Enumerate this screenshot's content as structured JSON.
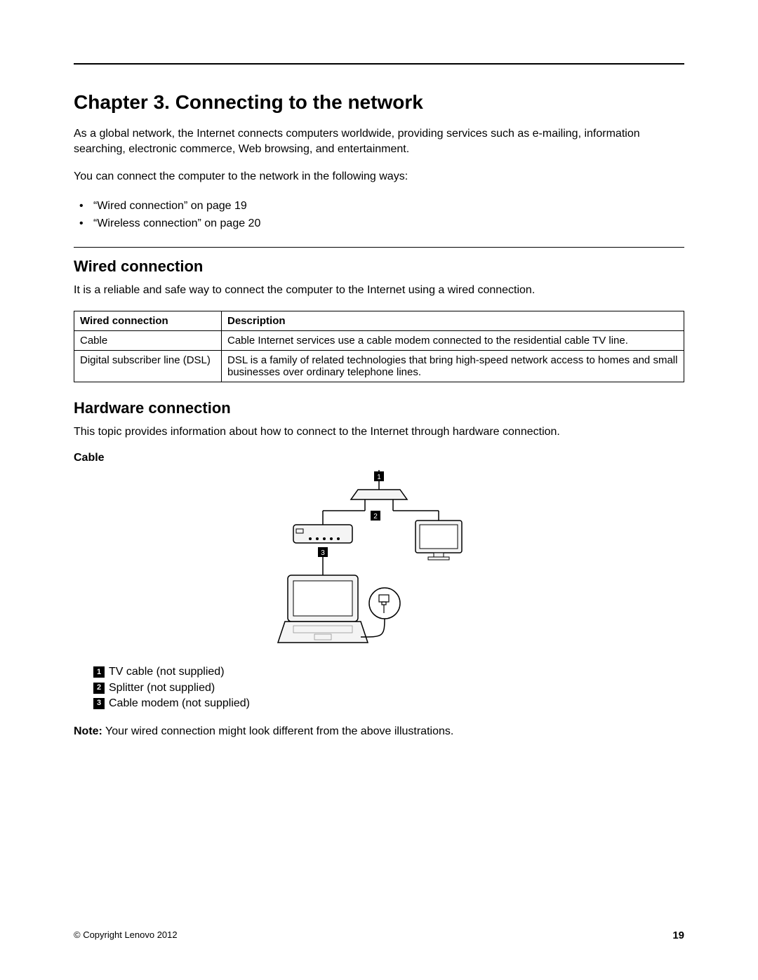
{
  "chapter_title": "Chapter 3.   Connecting to the network",
  "intro_p1": "As a global network, the Internet connects computers worldwide, providing services such as e-mailing, information searching, electronic commerce, Web browsing, and entertainment.",
  "intro_p2": "You can connect the computer to the network in the following ways:",
  "bullets": [
    "“Wired connection” on page 19",
    "“Wireless connection” on page 20"
  ],
  "wired": {
    "heading": "Wired connection",
    "intro": "It is a reliable and safe way to connect the computer to the Internet using a wired connection.",
    "table": {
      "headers": [
        "Wired connection",
        "Description"
      ],
      "rows": [
        [
          "Cable",
          "Cable Internet services use a cable modem connected to the residential cable TV line."
        ],
        [
          "Digital subscriber line (DSL)",
          "DSL is a family of related technologies that bring high-speed network access to homes and small businesses over ordinary telephone lines."
        ]
      ]
    }
  },
  "hardware": {
    "heading": "Hardware connection",
    "intro": "This topic provides information about how to connect to the Internet through hardware connection.",
    "sub_heading": "Cable",
    "legend": [
      {
        "num": "1",
        "text": "TV cable (not supplied)"
      },
      {
        "num": "2",
        "text": "Splitter (not supplied)"
      },
      {
        "num": "3",
        "text": "Cable modem (not supplied)"
      }
    ],
    "note_label": "Note:",
    "note_text": " Your wired connection might look different from the above illustrations."
  },
  "footer": {
    "copyright": "© Copyright Lenovo 2012",
    "page": "19"
  },
  "diagram_labels": {
    "n1": "1",
    "n2": "2",
    "n3": "3"
  }
}
